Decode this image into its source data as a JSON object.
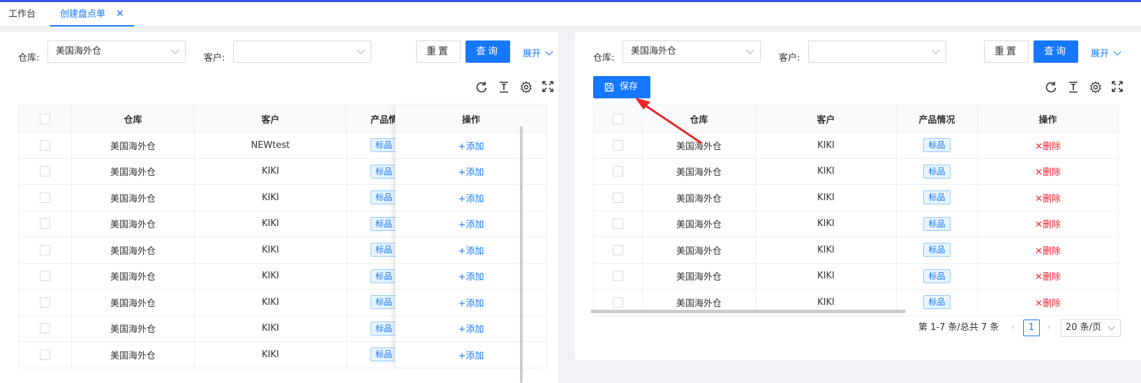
{
  "tabs": {
    "home": "工作台",
    "active": "创建盘点单"
  },
  "left": {
    "warehouse_label": "仓库:",
    "warehouse_value": "美国海外仓",
    "customer_label": "客户:",
    "customer_value": "",
    "reset": "重置",
    "query": "查询",
    "expand": "展开",
    "columns": [
      "仓库",
      "客户",
      "产品情况",
      "操作"
    ],
    "rows": [
      {
        "warehouse": "美国海外仓",
        "customer": "NEWtest",
        "tag": "标品",
        "action": "+添加"
      },
      {
        "warehouse": "美国海外仓",
        "customer": "KIKI",
        "tag": "标品",
        "action": "+添加"
      },
      {
        "warehouse": "美国海外仓",
        "customer": "KIKI",
        "tag": "标品",
        "action": "+添加"
      },
      {
        "warehouse": "美国海外仓",
        "customer": "KIKI",
        "tag": "标品",
        "action": "+添加"
      },
      {
        "warehouse": "美国海外仓",
        "customer": "KIKI",
        "tag": "标品",
        "action": "+添加"
      },
      {
        "warehouse": "美国海外仓",
        "customer": "KIKI",
        "tag": "标品",
        "action": "+添加"
      },
      {
        "warehouse": "美国海外仓",
        "customer": "KIKI",
        "tag": "标品",
        "action": "+添加"
      },
      {
        "warehouse": "美国海外仓",
        "customer": "KIKI",
        "tag": "标品",
        "action": "+添加"
      },
      {
        "warehouse": "美国海外仓",
        "customer": "KIKI",
        "tag": "标品",
        "action": "+添加"
      }
    ]
  },
  "right": {
    "warehouse_label": "仓库:",
    "warehouse_value": "美国海外仓",
    "customer_label": "客户:",
    "customer_value": "",
    "reset": "重置",
    "query": "查询",
    "expand": "展开",
    "save": "保存",
    "columns": [
      "仓库",
      "客户",
      "产品情况",
      "操作"
    ],
    "rows": [
      {
        "warehouse": "美国海外仓",
        "customer": "KIKI",
        "tag": "标品",
        "action": "✕删除"
      },
      {
        "warehouse": "美国海外仓",
        "customer": "KIKI",
        "tag": "标品",
        "action": "✕删除"
      },
      {
        "warehouse": "美国海外仓",
        "customer": "KIKI",
        "tag": "标品",
        "action": "✕删除"
      },
      {
        "warehouse": "美国海外仓",
        "customer": "KIKI",
        "tag": "标品",
        "action": "✕删除"
      },
      {
        "warehouse": "美国海外仓",
        "customer": "KIKI",
        "tag": "标品",
        "action": "✕删除"
      },
      {
        "warehouse": "美国海外仓",
        "customer": "KIKI",
        "tag": "标品",
        "action": "✕删除"
      },
      {
        "warehouse": "美国海外仓",
        "customer": "KIKI",
        "tag": "标品",
        "action": "✕删除"
      }
    ],
    "pagination": {
      "summary": "第 1-7 条/总共 7 条",
      "current": "1",
      "page_size": "20 条/页"
    }
  },
  "colors": {
    "primary": "#1677ff",
    "danger": "#f5222d",
    "annotation_arrow": "#e8262a"
  }
}
